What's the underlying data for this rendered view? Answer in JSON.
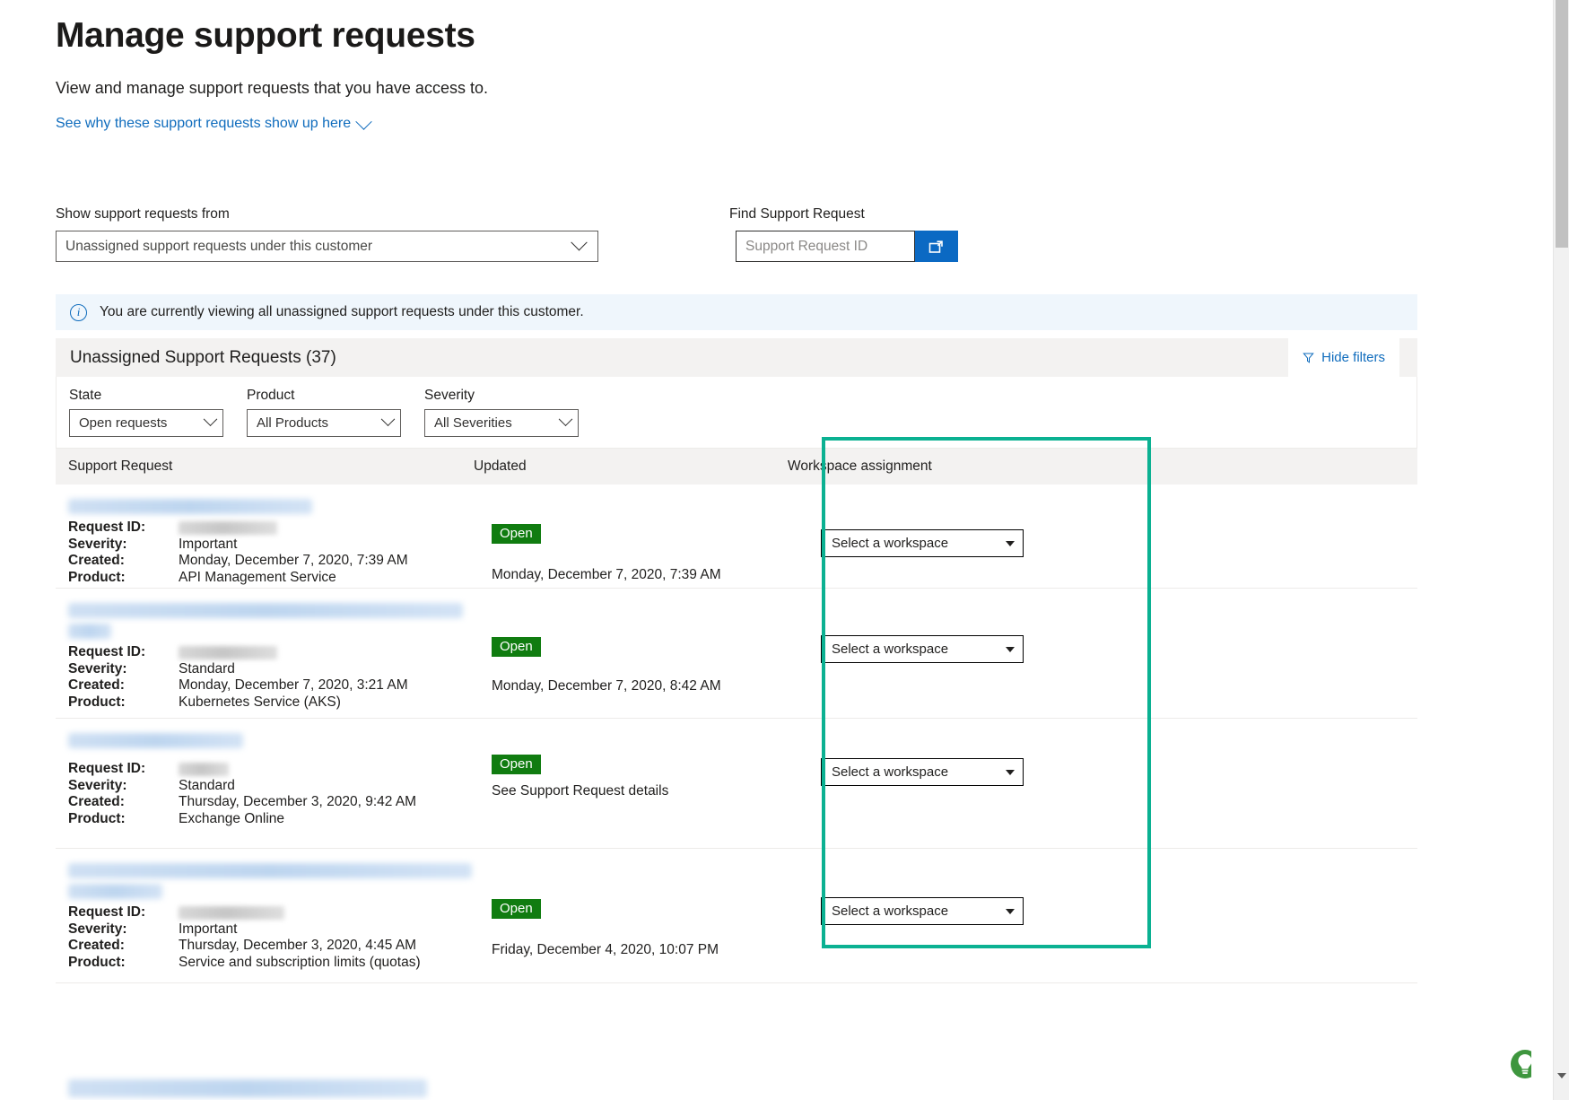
{
  "header": {
    "title": "Manage support requests",
    "subtitle": "View and manage support requests that you have access to.",
    "why_link": "See why these support requests show up here"
  },
  "top_controls": {
    "show_from_label": "Show support requests from",
    "show_from_value": "Unassigned support requests under this customer",
    "find_label": "Find Support Request",
    "find_placeholder": "Support Request ID",
    "find_value": "",
    "find_button_icon": "open-in-new-window-icon"
  },
  "info_banner": {
    "icon": "info-icon",
    "text": "You are currently viewing all unassigned support requests under this customer."
  },
  "card": {
    "title": "Unassigned Support Requests (37)",
    "hide_filters_label": "Hide filters",
    "hide_filters_icon": "funnel-icon",
    "filters": [
      {
        "label": "State",
        "value": "Open requests"
      },
      {
        "label": "Product",
        "value": "All Products"
      },
      {
        "label": "Severity",
        "value": "All Severities"
      }
    ],
    "columns": {
      "support_request": "Support Request",
      "updated": "Updated",
      "workspace_assignment": "Workspace assignment"
    },
    "labels": {
      "request_id": "Request ID:",
      "severity": "Severity:",
      "created": "Created:",
      "product": "Product:"
    },
    "workspace_placeholder": "Select a workspace",
    "rows": [
      {
        "title_redacted": true,
        "title_lines": 1,
        "request_id_redacted": true,
        "severity": "Important",
        "created": "Monday, December 7, 2020, 7:39 AM",
        "product": "API Management Service",
        "status": "Open",
        "updated": "Monday, December 7, 2020, 7:39 AM",
        "workspace": "Select a workspace"
      },
      {
        "title_redacted": true,
        "title_lines": 2,
        "request_id_redacted": true,
        "severity": "Standard",
        "created": "Monday, December 7, 2020, 3:21 AM",
        "product": "Kubernetes Service (AKS)",
        "status": "Open",
        "updated": "Monday, December 7, 2020, 8:42 AM",
        "workspace": "Select a workspace"
      },
      {
        "title_redacted": true,
        "title_lines": 1,
        "request_id_redacted": true,
        "severity": "Standard",
        "created": "Thursday, December 3, 2020, 9:42 AM",
        "product": "Exchange Online",
        "status": "Open",
        "updated": "See Support Request details",
        "workspace": "Select a workspace"
      },
      {
        "title_redacted": true,
        "title_lines": 2,
        "request_id_redacted": true,
        "severity": "Important",
        "created": "Thursday, December 3, 2020, 4:45 AM",
        "product": "Service and subscription limits (quotas)",
        "status": "Open",
        "updated": "Friday, December 4, 2020, 10:07 PM",
        "workspace": "Select a workspace"
      }
    ]
  },
  "annotation": {
    "highlight_color": "#0bb192"
  },
  "feedback_widget": {
    "icon": "feedback-lightbulb-icon",
    "color": "#3e963e"
  }
}
